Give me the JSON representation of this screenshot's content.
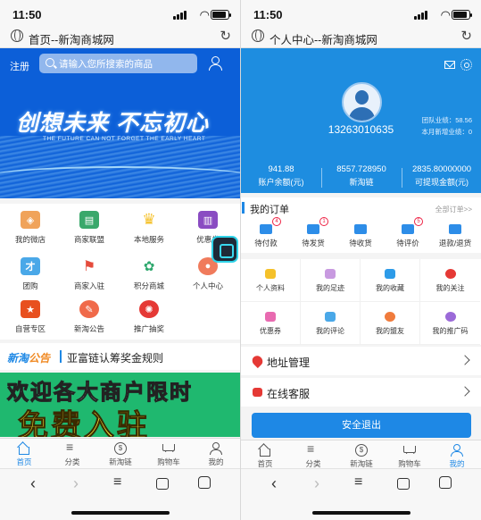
{
  "status_bar": {
    "time": "11:50"
  },
  "left": {
    "url_title": "首页--新淘商城网",
    "register": "注册",
    "search_placeholder": "请输入您所搜索的商品",
    "hero_title": "创想未来  不忘初心",
    "hero_subtitle": "THE FUTURE CAN NOT FORGET THE EARLY HEART",
    "grid": [
      {
        "label": "我的微店",
        "icon": "tag-icon",
        "color": "#f0a35a"
      },
      {
        "label": "商家联盟",
        "icon": "shop-icon",
        "color": "#3aa86b"
      },
      {
        "label": "本地服务",
        "icon": "crown-icon",
        "color": "#f5c12a"
      },
      {
        "label": "优惠券",
        "icon": "ticket-icon",
        "color": "#8a4cc2"
      },
      {
        "label": "团购",
        "icon": "group-icon",
        "color": "#4aa8e8"
      },
      {
        "label": "商家入驻",
        "icon": "flag-icon",
        "color": "#e54b3c"
      },
      {
        "label": "积分商城",
        "icon": "gift-icon",
        "color": "#2fa86e"
      },
      {
        "label": "个人中心",
        "icon": "user-icon",
        "color": "#f07b5c"
      },
      {
        "label": "自营专区",
        "icon": "bookmark-icon",
        "color": "#e8501f"
      },
      {
        "label": "新淘公告",
        "icon": "compass-icon",
        "color": "#f06a4a"
      },
      {
        "label": "推广抽奖",
        "icon": "wheel-icon",
        "color": "#e53935"
      }
    ],
    "news_tag_a": "新淘",
    "news_tag_b": "公告",
    "news_text": "亚富链认筹奖金规则",
    "banner_line1": "欢迎各大商户限时",
    "banner_line2": "免费入驻"
  },
  "tabs": [
    {
      "label": "首页",
      "icon": "home-icon"
    },
    {
      "label": "分类",
      "icon": "category-icon"
    },
    {
      "label": "新淘链",
      "icon": "coin-icon"
    },
    {
      "label": "购物车",
      "icon": "cart-icon"
    },
    {
      "label": "我的",
      "icon": "user-icon"
    }
  ],
  "right": {
    "url_title": "个人中心--新淘商城网",
    "phone": "13263010635",
    "team_perf": "团队业绩：58.56",
    "month_new": "本月新增业绩：0",
    "stats": [
      {
        "value": "941.88",
        "label": "账户余额(元)"
      },
      {
        "value": "8557.728950",
        "label": "新淘链"
      },
      {
        "value": "2835.80000000",
        "label": "可提现金额(元)"
      }
    ],
    "orders_title": "我的订单",
    "orders_all": "全部订单>>",
    "orders": [
      {
        "label": "待付款",
        "badge": "4"
      },
      {
        "label": "待发货",
        "badge": "1"
      },
      {
        "label": "待收货",
        "badge": ""
      },
      {
        "label": "待评价",
        "badge": "5"
      },
      {
        "label": "退款/退货",
        "badge": ""
      }
    ],
    "menu": [
      {
        "label": "个人资料",
        "color": "#f5c12a"
      },
      {
        "label": "我的足迹",
        "color": "#c89ae0"
      },
      {
        "label": "我的收藏",
        "color": "#2d9be8"
      },
      {
        "label": "我的关注",
        "color": "#e53935"
      },
      {
        "label": "优惠券",
        "color": "#e86ab0"
      },
      {
        "label": "我的评论",
        "color": "#4aa8e8"
      },
      {
        "label": "我的盟友",
        "color": "#f07b3c"
      },
      {
        "label": "我的推广码",
        "color": "#9b6ad8"
      }
    ],
    "address": "地址管理",
    "service": "在线客服",
    "logout": "安全退出"
  },
  "colors": {
    "accent": "#1e88e5",
    "hero_bg": "#0c5fd8",
    "profile_bg": "#1e8de0"
  }
}
